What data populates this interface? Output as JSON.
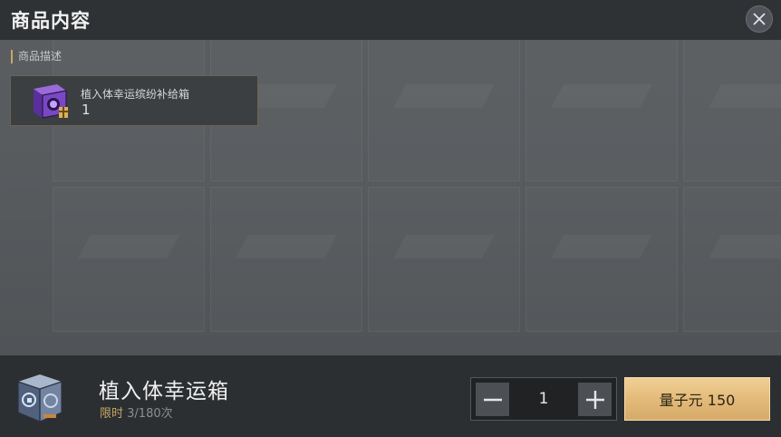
{
  "modal": {
    "title": "商品内容",
    "close_icon": "close-icon"
  },
  "description": {
    "section_label": "商品描述",
    "items": [
      {
        "name": "植入体幸运缤纷补给箱",
        "quantity": "1",
        "icon": "purple-supply-box-icon"
      }
    ]
  },
  "footer": {
    "product_name": "植入体幸运箱",
    "product_icon": "silver-implant-box-icon",
    "limit_label": "限时",
    "limit_value": "3/180次",
    "quantity": "1",
    "decrement_icon": "minus-icon",
    "increment_icon": "plus-icon",
    "price_label": "量子元 150"
  },
  "colors": {
    "accent_gold": "#c6a465",
    "buy_button": "#e2b978",
    "panel_dark": "#2c2f32"
  }
}
